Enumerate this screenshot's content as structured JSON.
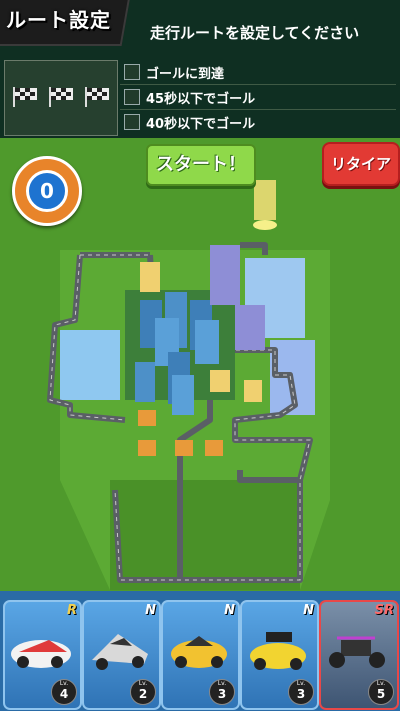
{
  "header": {
    "title": "ルート設定",
    "instruction": "走行ルートを設定してください"
  },
  "missions": [
    {
      "text": "ゴールに到達"
    },
    {
      "text": "45秒以下でゴール"
    },
    {
      "text": "40秒以下でゴール"
    }
  ],
  "buttons": {
    "start": "スタート！",
    "retire": "リタイア"
  },
  "counter": "0",
  "cars": [
    {
      "rarity": "R",
      "lv_label": "Lv.",
      "level": "4",
      "color": "#f2f2f2"
    },
    {
      "rarity": "N",
      "lv_label": "Lv.",
      "level": "2",
      "color": "#d9d9d9"
    },
    {
      "rarity": "N",
      "lv_label": "Lv.",
      "level": "3",
      "color": "#f2c230"
    },
    {
      "rarity": "N",
      "lv_label": "Lv.",
      "level": "3",
      "color": "#f2d430"
    },
    {
      "rarity": "SR",
      "lv_label": "Lv.",
      "level": "5",
      "color": "#333333"
    }
  ],
  "colors": {
    "grass": "#4f9a2c",
    "water": "#8fc8f0",
    "road": "#5a5f66",
    "start_button": "#8fd94a",
    "retire_button": "#e23a34"
  }
}
